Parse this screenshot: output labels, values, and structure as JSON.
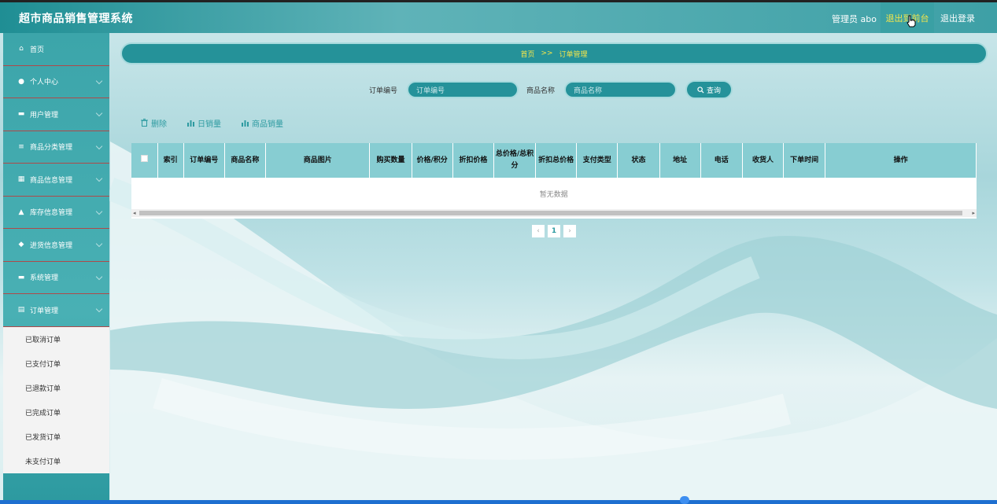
{
  "header": {
    "title": "超市商品销售管理系统",
    "user": "管理员 abo",
    "admin_button": "退出到前台",
    "logout_button": "退出登录"
  },
  "sidebar": {
    "items": [
      {
        "label": "首页",
        "icon": "home-icon"
      },
      {
        "label": "个人中心",
        "icon": "user-icon"
      },
      {
        "label": "用户管理",
        "icon": "users-icon"
      },
      {
        "label": "商品分类管理",
        "icon": "list-icon"
      },
      {
        "label": "商品信息管理",
        "icon": "grid-icon"
      },
      {
        "label": "库存信息管理",
        "icon": "person-icon"
      },
      {
        "label": "进货信息管理",
        "icon": "pin-icon"
      },
      {
        "label": "系统管理",
        "icon": "monitor-icon"
      },
      {
        "label": "订单管理",
        "icon": "doc-icon"
      }
    ],
    "submenu": [
      "已取消订单",
      "已支付订单",
      "已退款订单",
      "已完成订单",
      "已发货订单",
      "未支付订单"
    ]
  },
  "breadcrumb": {
    "home": "首页",
    "separator": ">>",
    "current": "订单管理"
  },
  "search": {
    "order_label": "订单编号",
    "order_placeholder": "订单编号",
    "product_label": "商品名称",
    "product_placeholder": "商品名称",
    "query_button": "查询"
  },
  "actions": {
    "delete": "删除",
    "daily_sales": "日销量",
    "product_sales": "商品销量"
  },
  "table": {
    "columns": [
      "索引",
      "订单编号",
      "商品名称",
      "商品图片",
      "购买数量",
      "价格/积分",
      "折扣价格",
      "总价格/总积分",
      "折扣总价格",
      "支付类型",
      "状态",
      "地址",
      "电话",
      "收货人",
      "下单时间",
      "操作"
    ],
    "empty_text": "暂无数据"
  },
  "pagination": {
    "prev": "‹",
    "current": "1",
    "next": "›"
  },
  "colors": {
    "accent": "#25929a",
    "highlight": "#f5e64a"
  }
}
